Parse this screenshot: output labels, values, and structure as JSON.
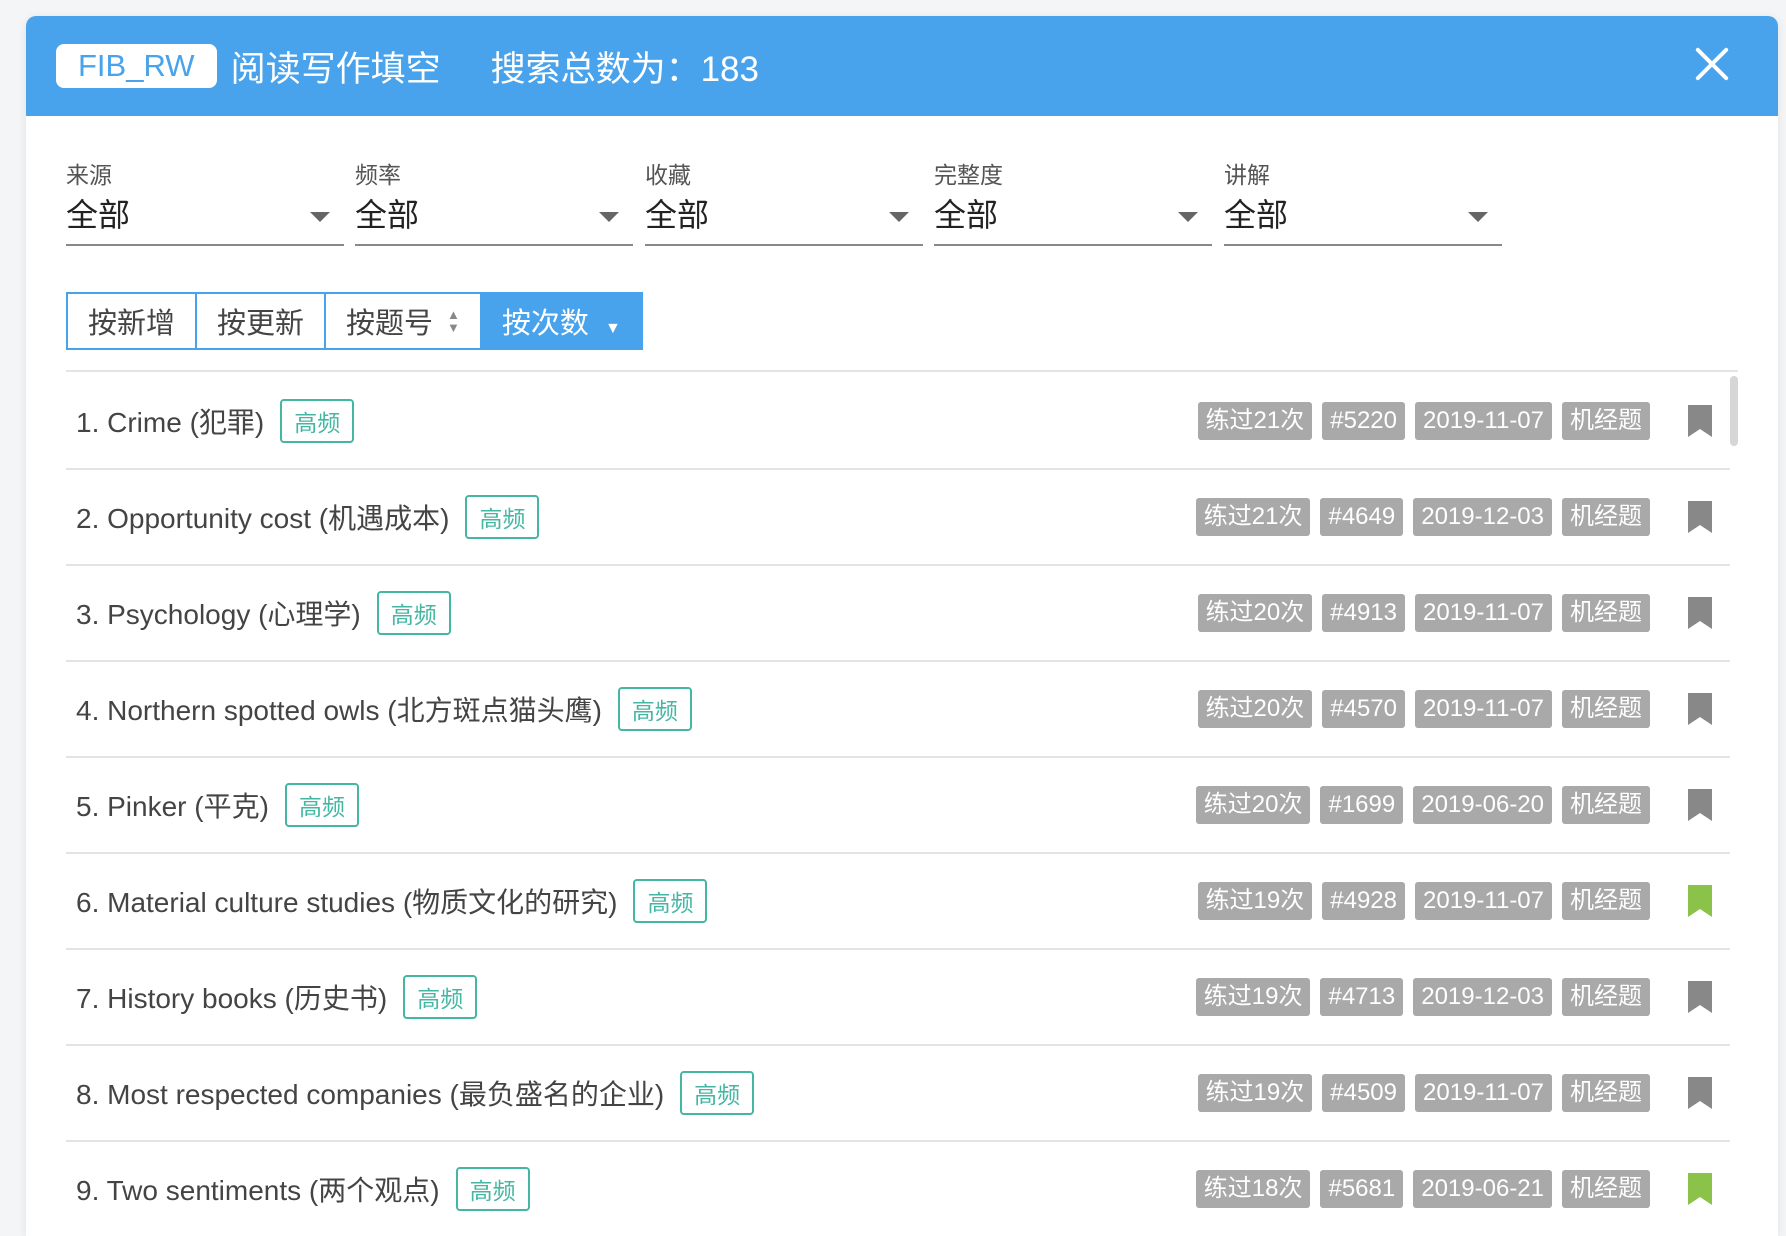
{
  "header": {
    "code": "FIB_RW",
    "title": "阅读写作填空",
    "count_text": "搜索总数为：183"
  },
  "filters": [
    {
      "label": "来源",
      "value": "全部"
    },
    {
      "label": "频率",
      "value": "全部"
    },
    {
      "label": "收藏",
      "value": "全部"
    },
    {
      "label": "完整度",
      "value": "全部"
    },
    {
      "label": "讲解",
      "value": "全部"
    }
  ],
  "sort": {
    "new": "按新增",
    "update": "按更新",
    "number": "按题号",
    "count": "按次数",
    "active": "count"
  },
  "colors": {
    "header": "#48a3ec",
    "tag_high": "#44b7a3",
    "meta_tag": "#a9a9a9",
    "bookmark_off": "#888888",
    "bookmark_on": "#8ac24a"
  },
  "items": [
    {
      "title": "1. Crime (犯罪)",
      "tag": "高频",
      "practiced": "练过21次",
      "id": "#5220",
      "date": "2019-11-07",
      "type": "机经题",
      "bookmarked": false
    },
    {
      "title": "2. Opportunity cost (机遇成本)",
      "tag": "高频",
      "practiced": "练过21次",
      "id": "#4649",
      "date": "2019-12-03",
      "type": "机经题",
      "bookmarked": false
    },
    {
      "title": "3. Psychology (心理学)",
      "tag": "高频",
      "practiced": "练过20次",
      "id": "#4913",
      "date": "2019-11-07",
      "type": "机经题",
      "bookmarked": false
    },
    {
      "title": "4. Northern spotted owls (北方斑点猫头鹰)",
      "tag": "高频",
      "practiced": "练过20次",
      "id": "#4570",
      "date": "2019-11-07",
      "type": "机经题",
      "bookmarked": false
    },
    {
      "title": "5. Pinker (平克)",
      "tag": "高频",
      "practiced": "练过20次",
      "id": "#1699",
      "date": "2019-06-20",
      "type": "机经题",
      "bookmarked": false
    },
    {
      "title": "6. Material culture studies (物质文化的研究)",
      "tag": "高频",
      "practiced": "练过19次",
      "id": "#4928",
      "date": "2019-11-07",
      "type": "机经题",
      "bookmarked": true
    },
    {
      "title": "7. History books (历史书)",
      "tag": "高频",
      "practiced": "练过19次",
      "id": "#4713",
      "date": "2019-12-03",
      "type": "机经题",
      "bookmarked": false
    },
    {
      "title": "8. Most respected companies (最负盛名的企业)",
      "tag": "高频",
      "practiced": "练过19次",
      "id": "#4509",
      "date": "2019-11-07",
      "type": "机经题",
      "bookmarked": false
    },
    {
      "title": "9. Two sentiments (两个观点)",
      "tag": "高频",
      "practiced": "练过18次",
      "id": "#5681",
      "date": "2019-06-21",
      "type": "机经题",
      "bookmarked": true
    }
  ]
}
